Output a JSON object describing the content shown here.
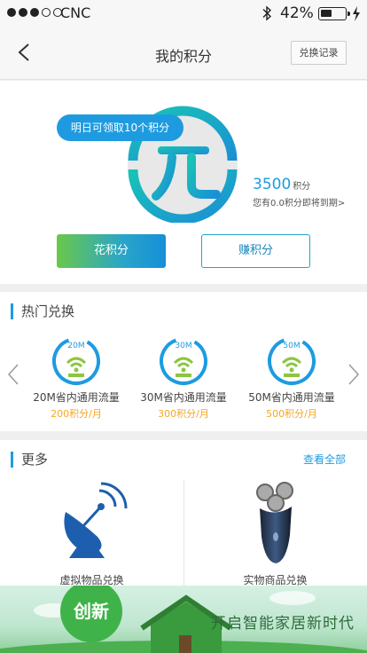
{
  "status_bar": {
    "carrier": "CNC",
    "battery_percent": "42%",
    "battery_level": 0.42,
    "signal_bars": 3
  },
  "navbar": {
    "title": "我的积分",
    "record_button": "兑换记录"
  },
  "points": {
    "tip": "明日可领取10个积分",
    "value": "3500",
    "unit": "积分",
    "expire_note": "您有0.0积分即将到期>",
    "spend_button": "花积分",
    "earn_button": "赚积分"
  },
  "hot": {
    "title": "热门兑换",
    "items": [
      {
        "badge": "20M",
        "name": "20M省内通用流量",
        "price": "200积分/月"
      },
      {
        "badge": "30M",
        "name": "30M省内通用流量",
        "price": "300积分/月"
      },
      {
        "badge": "50M",
        "name": "50M省内通用流量",
        "price": "500积分/月"
      }
    ]
  },
  "more": {
    "title": "更多",
    "view_all": "查看全部",
    "categories": [
      {
        "label": "虚拟物品兑换",
        "icon": "satellite-dish-icon"
      },
      {
        "label": "实物商品兑换",
        "icon": "shaver-icon"
      }
    ]
  },
  "banner": {
    "badge": "创新",
    "slogan": "开启智能家居新时代"
  },
  "colors": {
    "accent": "#1e9be0",
    "green": "#6ac84a",
    "price": "#f5a623"
  }
}
